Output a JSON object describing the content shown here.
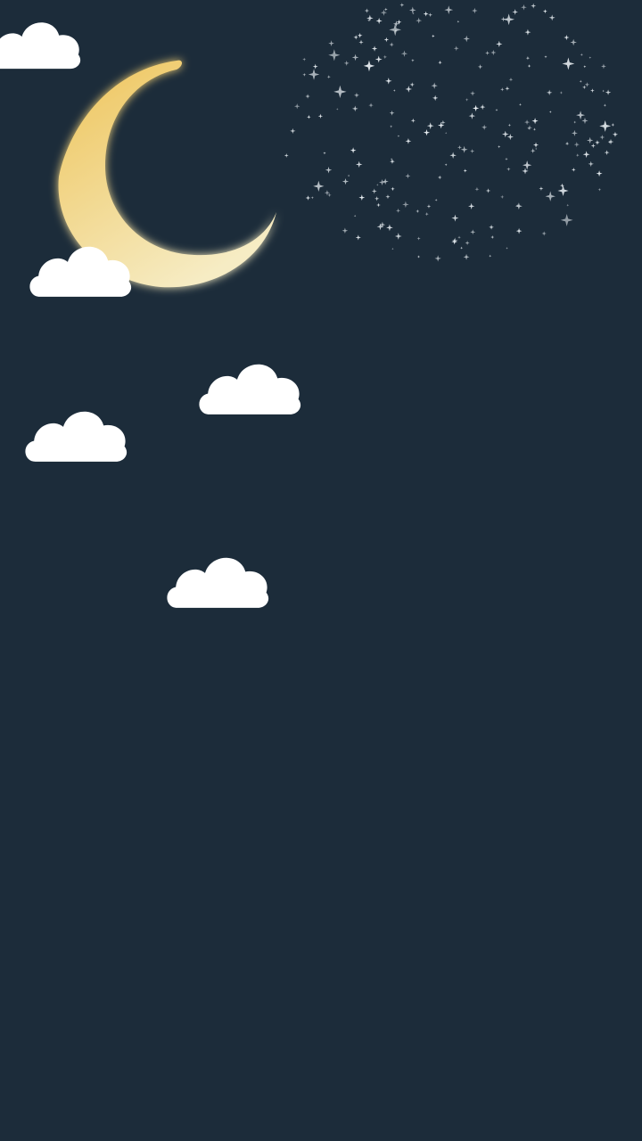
{
  "wallpaper": {
    "background_color": "#1c2c3a",
    "moon": {
      "icon": "crescent-moon-icon",
      "color_top": "#eec45a",
      "color_bottom": "#f6ecc4"
    },
    "cloud": {
      "icon": "cloud-icon",
      "color": "#ffffff",
      "count": 5
    },
    "stars": {
      "icon": "sparkle-star-icon",
      "color": "#e8eef2"
    }
  }
}
